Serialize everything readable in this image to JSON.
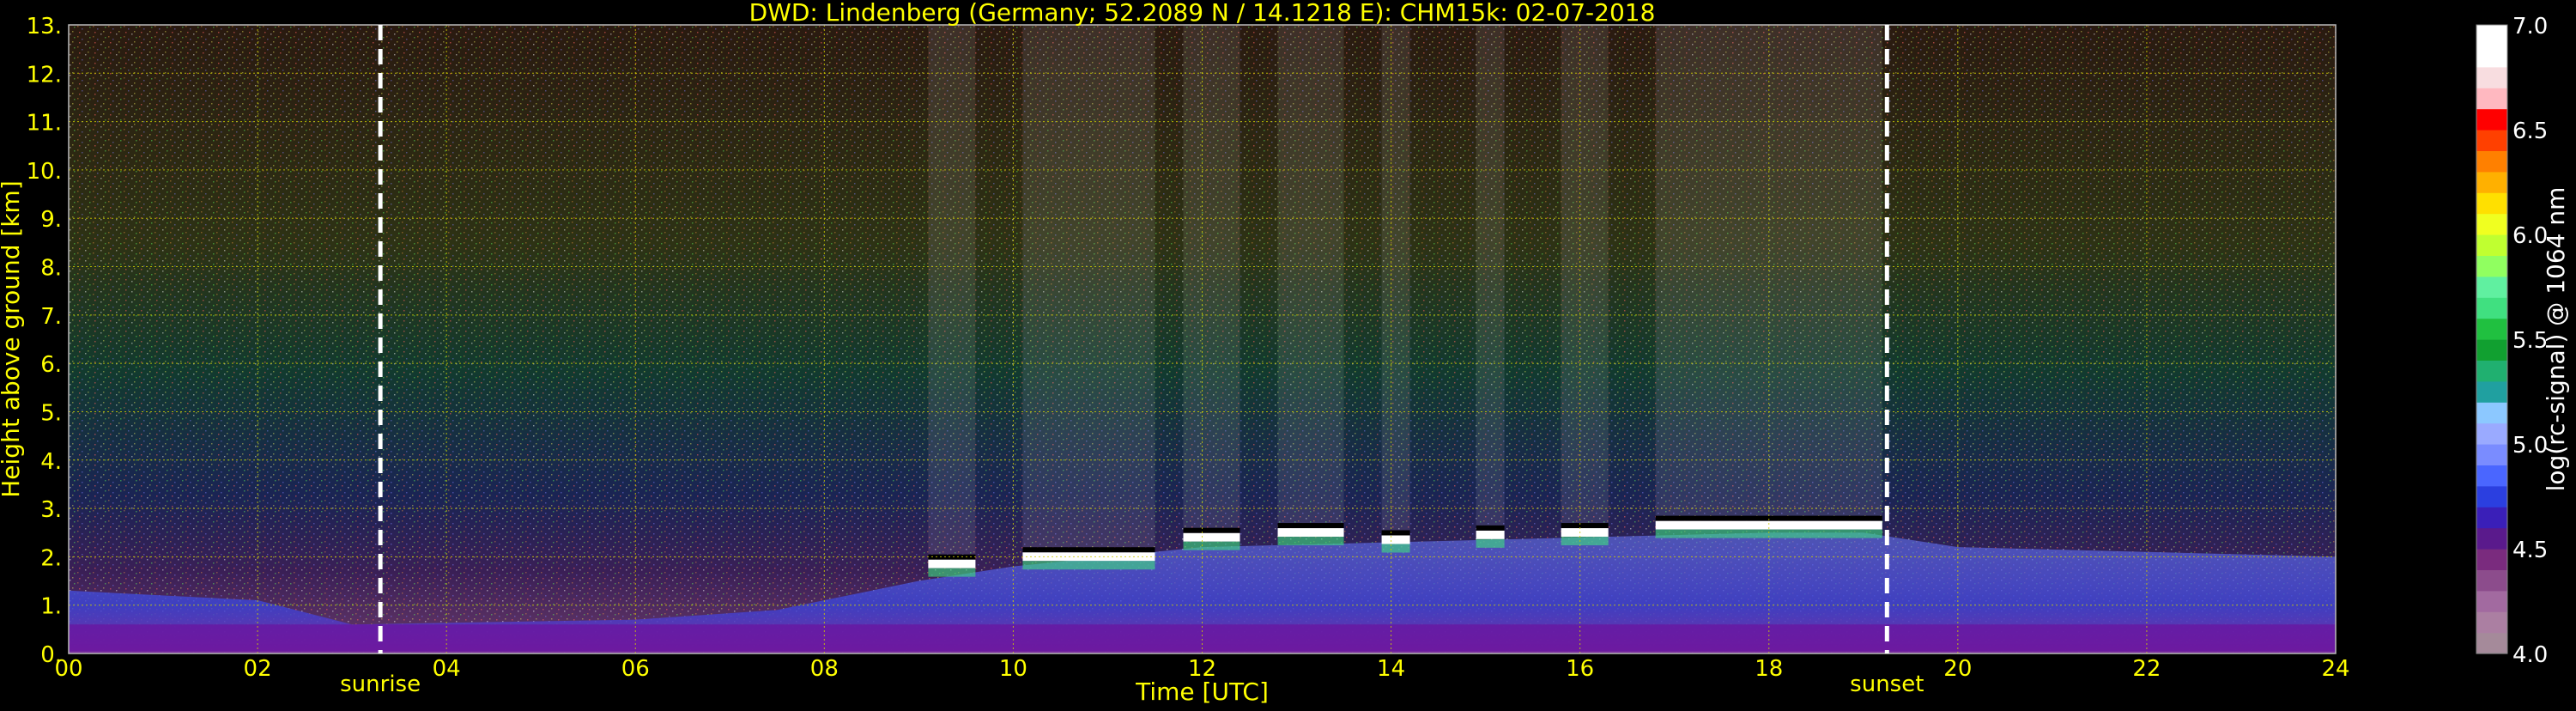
{
  "chart_data": {
    "type": "heatmap",
    "title": "DWD: Lindenberg (Germany; 52.2089 N / 14.1218 E):    CHM15k: 02-07-2018",
    "xlabel": "Time [UTC]",
    "ylabel": "Height above ground [km]",
    "x_unit": "hours UTC",
    "y_unit": "km",
    "xlim": [
      0,
      24
    ],
    "ylim": [
      0,
      13
    ],
    "x_ticks": [
      0,
      2,
      4,
      6,
      8,
      10,
      12,
      14,
      16,
      18,
      20,
      22,
      24
    ],
    "x_tick_labels": [
      "00",
      "02",
      "04",
      "06",
      "08",
      "10",
      "12",
      "14",
      "16",
      "18",
      "20",
      "22",
      "24"
    ],
    "y_ticks": [
      0,
      1,
      2,
      3,
      4,
      5,
      6,
      7,
      8,
      9,
      10,
      11,
      12,
      13
    ],
    "y_tick_labels": [
      "0.",
      "1.",
      "2.",
      "3.",
      "4.",
      "5.",
      "6.",
      "7.",
      "8.",
      "9.",
      "10.",
      "11.",
      "12.",
      "13."
    ],
    "grid": true,
    "grid_color": "#cccc00",
    "text_color": "#ffff00",
    "annotations": [
      {
        "label": "sunrise",
        "x": 3.3
      },
      {
        "label": "sunset",
        "x": 19.25
      }
    ],
    "colorbar": {
      "label": "log(rc-signal) @ 1064 nm",
      "range": [
        4.0,
        7.0
      ],
      "tick_values": [
        4.0,
        4.5,
        5.0,
        5.5,
        6.0,
        6.5,
        7.0
      ],
      "tick_labels": [
        "4.0",
        "4.5",
        "5.0",
        "5.5",
        "6.0",
        "6.5",
        "7.0"
      ],
      "colors": [
        "#a58a9a",
        "#ab7fa2",
        "#a26aa0",
        "#8c4c8c",
        "#7a2b7e",
        "#5a1a8c",
        "#3a1fb8",
        "#2b3fe0",
        "#4a66ff",
        "#7a8cff",
        "#9aaaff",
        "#8cc8ff",
        "#20a0a0",
        "#20b070",
        "#11a030",
        "#20c040",
        "#40e080",
        "#60f0a0",
        "#90ff60",
        "#c0ff30",
        "#f0ff20",
        "#ffe000",
        "#ffb000",
        "#ff8000",
        "#ff4000",
        "#ff0000",
        "#ffb8c0",
        "#f8dde0",
        "#ffffff",
        "#ffffff"
      ]
    },
    "features": {
      "cloud_base_km": [
        {
          "start": 9.1,
          "end": 9.6,
          "height": 1.8
        },
        {
          "start": 10.1,
          "end": 11.5,
          "height": 1.95
        },
        {
          "start": 11.8,
          "end": 12.4,
          "height": 2.35
        },
        {
          "start": 12.8,
          "end": 13.5,
          "height": 2.45
        },
        {
          "start": 13.9,
          "end": 14.2,
          "height": 2.3
        },
        {
          "start": 14.9,
          "end": 15.2,
          "height": 2.4
        },
        {
          "start": 15.8,
          "end": 16.3,
          "height": 2.45
        },
        {
          "start": 16.8,
          "end": 19.2,
          "height": 2.6
        }
      ],
      "mixing_layer_km": [
        {
          "x": 0,
          "h": 1.3
        },
        {
          "x": 2,
          "h": 1.1
        },
        {
          "x": 3,
          "h": 0.6
        },
        {
          "x": 6,
          "h": 0.7
        },
        {
          "x": 7.5,
          "h": 0.9
        },
        {
          "x": 8,
          "h": 1.1
        },
        {
          "x": 9,
          "h": 1.5
        },
        {
          "x": 10,
          "h": 1.8
        },
        {
          "x": 12,
          "h": 2.2
        },
        {
          "x": 14,
          "h": 2.3
        },
        {
          "x": 16,
          "h": 2.4
        },
        {
          "x": 18,
          "h": 2.5
        },
        {
          "x": 19,
          "h": 2.5
        },
        {
          "x": 20,
          "h": 2.2
        },
        {
          "x": 22,
          "h": 2.1
        },
        {
          "x": 24,
          "h": 2.0
        }
      ]
    }
  }
}
